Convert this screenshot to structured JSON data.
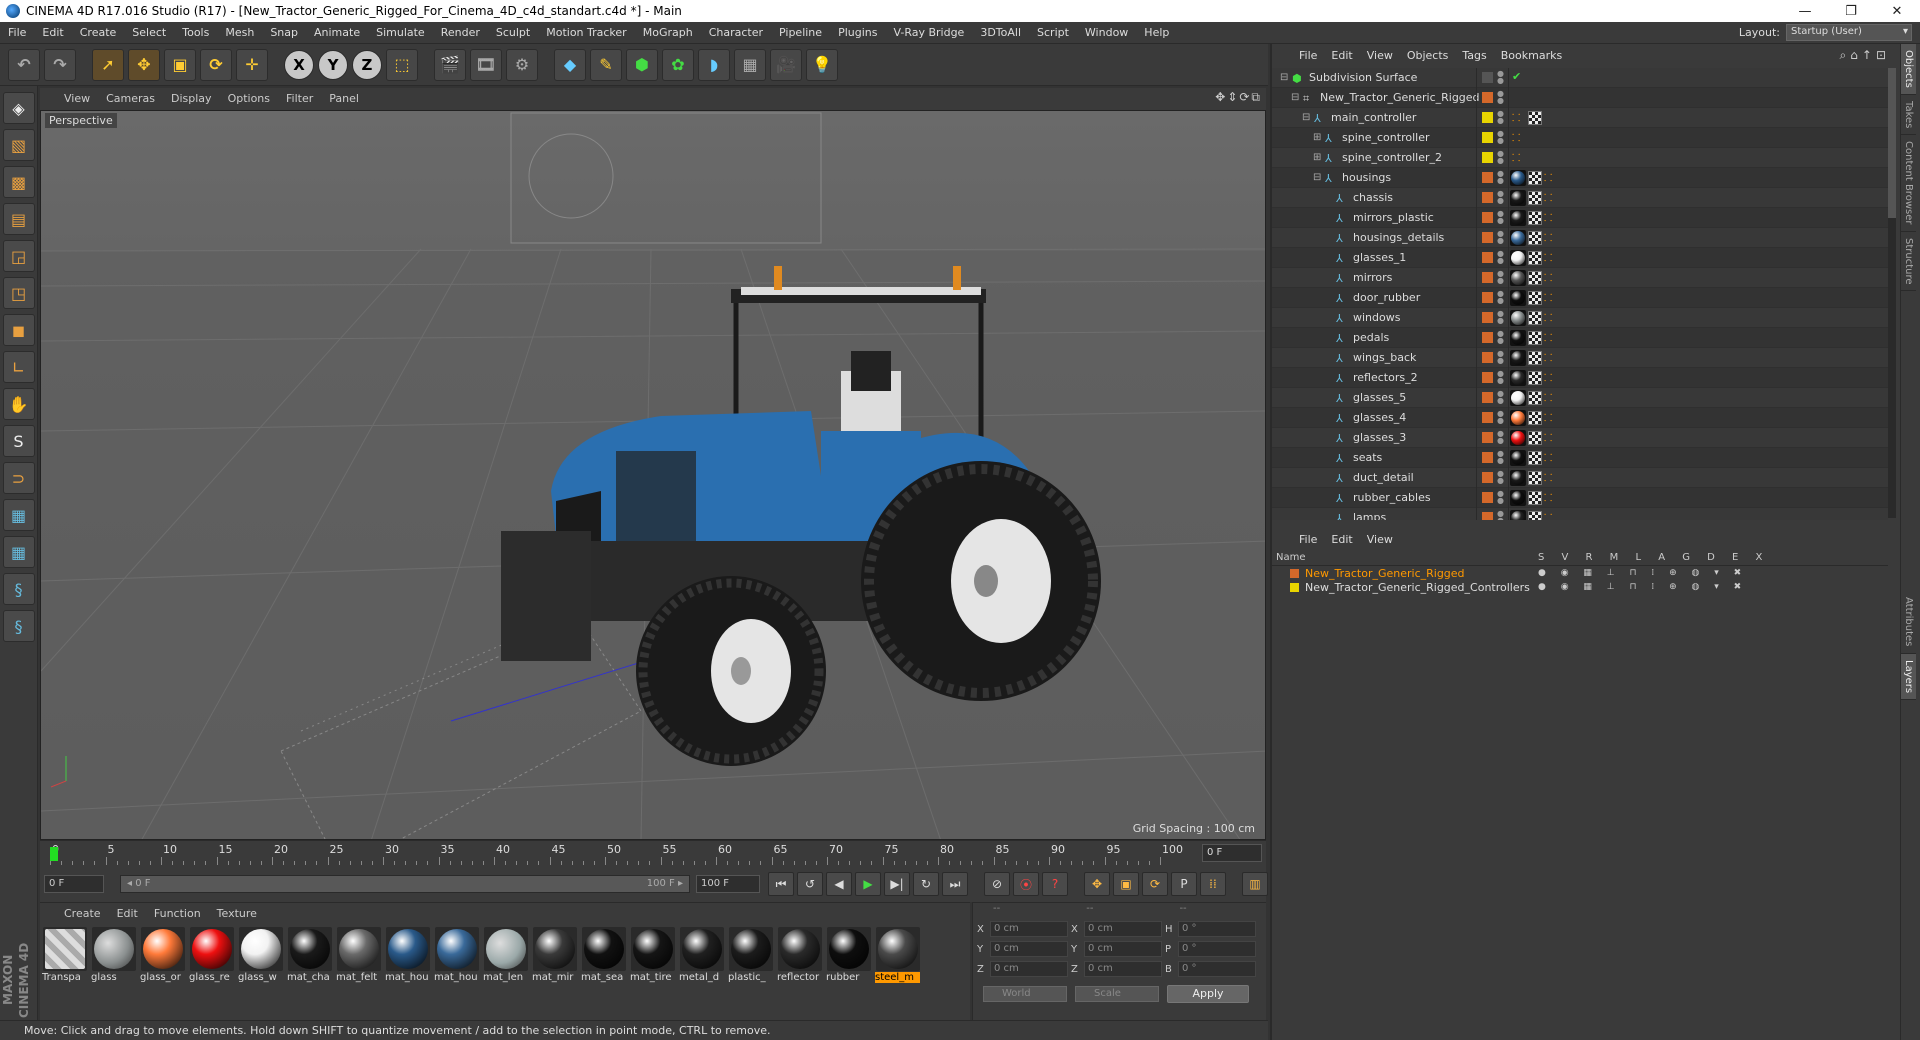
{
  "window": {
    "title": "CINEMA 4D R17.016 Studio (R17) - [New_Tractor_Generic_Rigged_For_Cinema_4D_c4d_standart.c4d *] - Main",
    "minimize": "—",
    "maximize": "❐",
    "close": "✕"
  },
  "menubar": {
    "items": [
      "File",
      "Edit",
      "Create",
      "Select",
      "Tools",
      "Mesh",
      "Snap",
      "Animate",
      "Simulate",
      "Render",
      "Sculpt",
      "Motion Tracker",
      "MoGraph",
      "Character",
      "Pipeline",
      "Plugins",
      "V-Ray Bridge",
      "3DToAll",
      "Script",
      "Window",
      "Help"
    ],
    "layout_label": "Layout:",
    "layout_value": "Startup (User)"
  },
  "viewport": {
    "menu": [
      "View",
      "Cameras",
      "Display",
      "Options",
      "Filter",
      "Panel"
    ],
    "label": "Perspective",
    "grid_spacing": "Grid Spacing : 100 cm"
  },
  "timeline": {
    "ticks": [
      "0",
      "5",
      "10",
      "15",
      "20",
      "25",
      "30",
      "35",
      "40",
      "45",
      "50",
      "55",
      "60",
      "65",
      "70",
      "75",
      "80",
      "85",
      "90",
      "95",
      "100"
    ],
    "current_frame": "0 F",
    "start_frame": "0 F",
    "slider_left": "◂ 0 F",
    "slider_right": "100 F ▸",
    "end_frame": "100 F"
  },
  "materials": {
    "menu": [
      "Create",
      "Edit",
      "Function",
      "Texture"
    ],
    "items": [
      {
        "label": "Transpa",
        "color": "#cfcfcf",
        "style": "checker"
      },
      {
        "label": "glass",
        "color": "#8a8f8f",
        "style": "glass"
      },
      {
        "label": "glass_or",
        "color": "#ff7a3a",
        "style": "solid"
      },
      {
        "label": "glass_re",
        "color": "#ee1010",
        "style": "solid"
      },
      {
        "label": "glass_w",
        "color": "#f2f2f2",
        "style": "solid"
      },
      {
        "label": "mat_cha",
        "color": "#1a1a1a",
        "style": "solid"
      },
      {
        "label": "mat_felt",
        "color": "#6a6a6a",
        "style": "solid"
      },
      {
        "label": "mat_hou",
        "color": "#2a5a8a",
        "style": "solid"
      },
      {
        "label": "mat_hou",
        "color": "#3a6a9a",
        "style": "solid"
      },
      {
        "label": "mat_len",
        "color": "#9aa8a8",
        "style": "glass"
      },
      {
        "label": "mat_mir",
        "color": "#3a3a3a",
        "style": "solid"
      },
      {
        "label": "mat_sea",
        "color": "#111111",
        "style": "solid"
      },
      {
        "label": "mat_tire",
        "color": "#151515",
        "style": "solid"
      },
      {
        "label": "metal_d",
        "color": "#202020",
        "style": "solid"
      },
      {
        "label": "plastic_",
        "color": "#1c1c1c",
        "style": "solid"
      },
      {
        "label": "reflector",
        "color": "#2a2a2a",
        "style": "solid"
      },
      {
        "label": "rubber",
        "color": "#0e0e0e",
        "style": "solid"
      },
      {
        "label": "steel_m",
        "color": "#4a4a4a",
        "style": "solid",
        "selected": true
      }
    ]
  },
  "coords": {
    "headers": [
      "--",
      "--",
      "--"
    ],
    "rows": [
      {
        "a": "X",
        "v1": "0 cm",
        "b": "X",
        "v2": "0 cm",
        "c": "H",
        "v3": "0 °"
      },
      {
        "a": "Y",
        "v1": "0 cm",
        "b": "Y",
        "v2": "0 cm",
        "c": "P",
        "v3": "0 °"
      },
      {
        "a": "Z",
        "v1": "0 cm",
        "b": "Z",
        "v2": "0 cm",
        "c": "B",
        "v3": "0 °"
      }
    ],
    "mode_world": "World",
    "mode_scale": "Scale",
    "apply": "Apply"
  },
  "status": "Move: Click and drag to move elements. Hold down SHIFT to quantize movement / add to the selection in point mode, CTRL to remove.",
  "objects_panel": {
    "menu": [
      "File",
      "Edit",
      "View",
      "Objects",
      "Tags",
      "Bookmarks"
    ],
    "rows": [
      {
        "name": "Subdivision Surface",
        "depth": 0,
        "expander": "⊟",
        "icon": "subdivision",
        "layer": "#555555",
        "tag": "check"
      },
      {
        "name": "New_Tractor_Generic_Rigged",
        "depth": 1,
        "expander": "⊟",
        "icon": "null",
        "layer": "#d4682a",
        "tag": "none"
      },
      {
        "name": "main_controller",
        "depth": 2,
        "expander": "⊟",
        "icon": "joint",
        "layer": "#e8d400",
        "tag": "ik-check"
      },
      {
        "name": "spine_controller",
        "depth": 3,
        "expander": "⊞",
        "icon": "joint",
        "layer": "#e8d400",
        "tag": "ik"
      },
      {
        "name": "spine_controller_2",
        "depth": 3,
        "expander": "⊞",
        "icon": "joint",
        "layer": "#e8d400",
        "tag": "ik"
      },
      {
        "name": "housings",
        "depth": 3,
        "expander": "⊟",
        "icon": "joint",
        "layer": "#d4682a",
        "tag": "mat",
        "mat": "#2a5a8a"
      },
      {
        "name": "chassis",
        "depth": 4,
        "expander": "",
        "icon": "joint",
        "layer": "#d4682a",
        "tag": "mat",
        "mat": "#1a1a1a"
      },
      {
        "name": "mirrors_plastic",
        "depth": 4,
        "expander": "",
        "icon": "joint",
        "layer": "#d4682a",
        "tag": "mat",
        "mat": "#1c1c1c"
      },
      {
        "name": "housings_details",
        "depth": 4,
        "expander": "",
        "icon": "joint",
        "layer": "#d4682a",
        "tag": "mat",
        "mat": "#3a6a9a"
      },
      {
        "name": "glasses_1",
        "depth": 4,
        "expander": "",
        "icon": "joint",
        "layer": "#d4682a",
        "tag": "mat",
        "mat": "#f2f2f2"
      },
      {
        "name": "mirrors",
        "depth": 4,
        "expander": "",
        "icon": "joint",
        "layer": "#d4682a",
        "tag": "mat",
        "mat": "#555555"
      },
      {
        "name": "door_rubber",
        "depth": 4,
        "expander": "",
        "icon": "joint",
        "layer": "#d4682a",
        "tag": "mat",
        "mat": "#0e0e0e"
      },
      {
        "name": "windows",
        "depth": 4,
        "expander": "",
        "icon": "joint",
        "layer": "#d4682a",
        "tag": "mat",
        "mat": "#8a8f8f"
      },
      {
        "name": "pedals",
        "depth": 4,
        "expander": "",
        "icon": "joint",
        "layer": "#d4682a",
        "tag": "mat",
        "mat": "#111111"
      },
      {
        "name": "wings_back",
        "depth": 4,
        "expander": "",
        "icon": "joint",
        "layer": "#d4682a",
        "tag": "mat",
        "mat": "#1a1a1a"
      },
      {
        "name": "reflectors_2",
        "depth": 4,
        "expander": "",
        "icon": "joint",
        "layer": "#d4682a",
        "tag": "mat",
        "mat": "#2a2a2a"
      },
      {
        "name": "glasses_5",
        "depth": 4,
        "expander": "",
        "icon": "joint",
        "layer": "#d4682a",
        "tag": "mat",
        "mat": "#f2f2f2"
      },
      {
        "name": "glasses_4",
        "depth": 4,
        "expander": "",
        "icon": "joint",
        "layer": "#d4682a",
        "tag": "mat",
        "mat": "#ff7a3a"
      },
      {
        "name": "glasses_3",
        "depth": 4,
        "expander": "",
        "icon": "joint",
        "layer": "#d4682a",
        "tag": "mat",
        "mat": "#ee1010"
      },
      {
        "name": "seats",
        "depth": 4,
        "expander": "",
        "icon": "joint",
        "layer": "#d4682a",
        "tag": "mat",
        "mat": "#111111"
      },
      {
        "name": "duct_detail",
        "depth": 4,
        "expander": "",
        "icon": "joint",
        "layer": "#d4682a",
        "tag": "mat",
        "mat": "#1a1a1a"
      },
      {
        "name": "rubber_cables",
        "depth": 4,
        "expander": "",
        "icon": "joint",
        "layer": "#d4682a",
        "tag": "mat",
        "mat": "#0e0e0e"
      },
      {
        "name": "lamps",
        "depth": 4,
        "expander": "",
        "icon": "joint",
        "layer": "#d4682a",
        "tag": "mat",
        "mat": "#222222"
      }
    ]
  },
  "layers_panel": {
    "menu": [
      "File",
      "Edit",
      "View"
    ],
    "name_header": "Name",
    "col_headers": "S V R M L A G D E X",
    "rows": [
      {
        "name": "New_Tractor_Generic_Rigged",
        "color": "#d4682a",
        "text_color": "#f90"
      },
      {
        "name": "New_Tractor_Generic_Rigged_Controllers",
        "color": "#e8d400",
        "text_color": "#ddd"
      }
    ]
  },
  "side_tabs": [
    "Objects",
    "Takes",
    "Content Browser",
    "Structure",
    "Attributes",
    "Layers"
  ],
  "colors": {
    "accent": "#ff9900",
    "tractor_blue": "#2a6fb0",
    "background": "#3a3a3a"
  }
}
